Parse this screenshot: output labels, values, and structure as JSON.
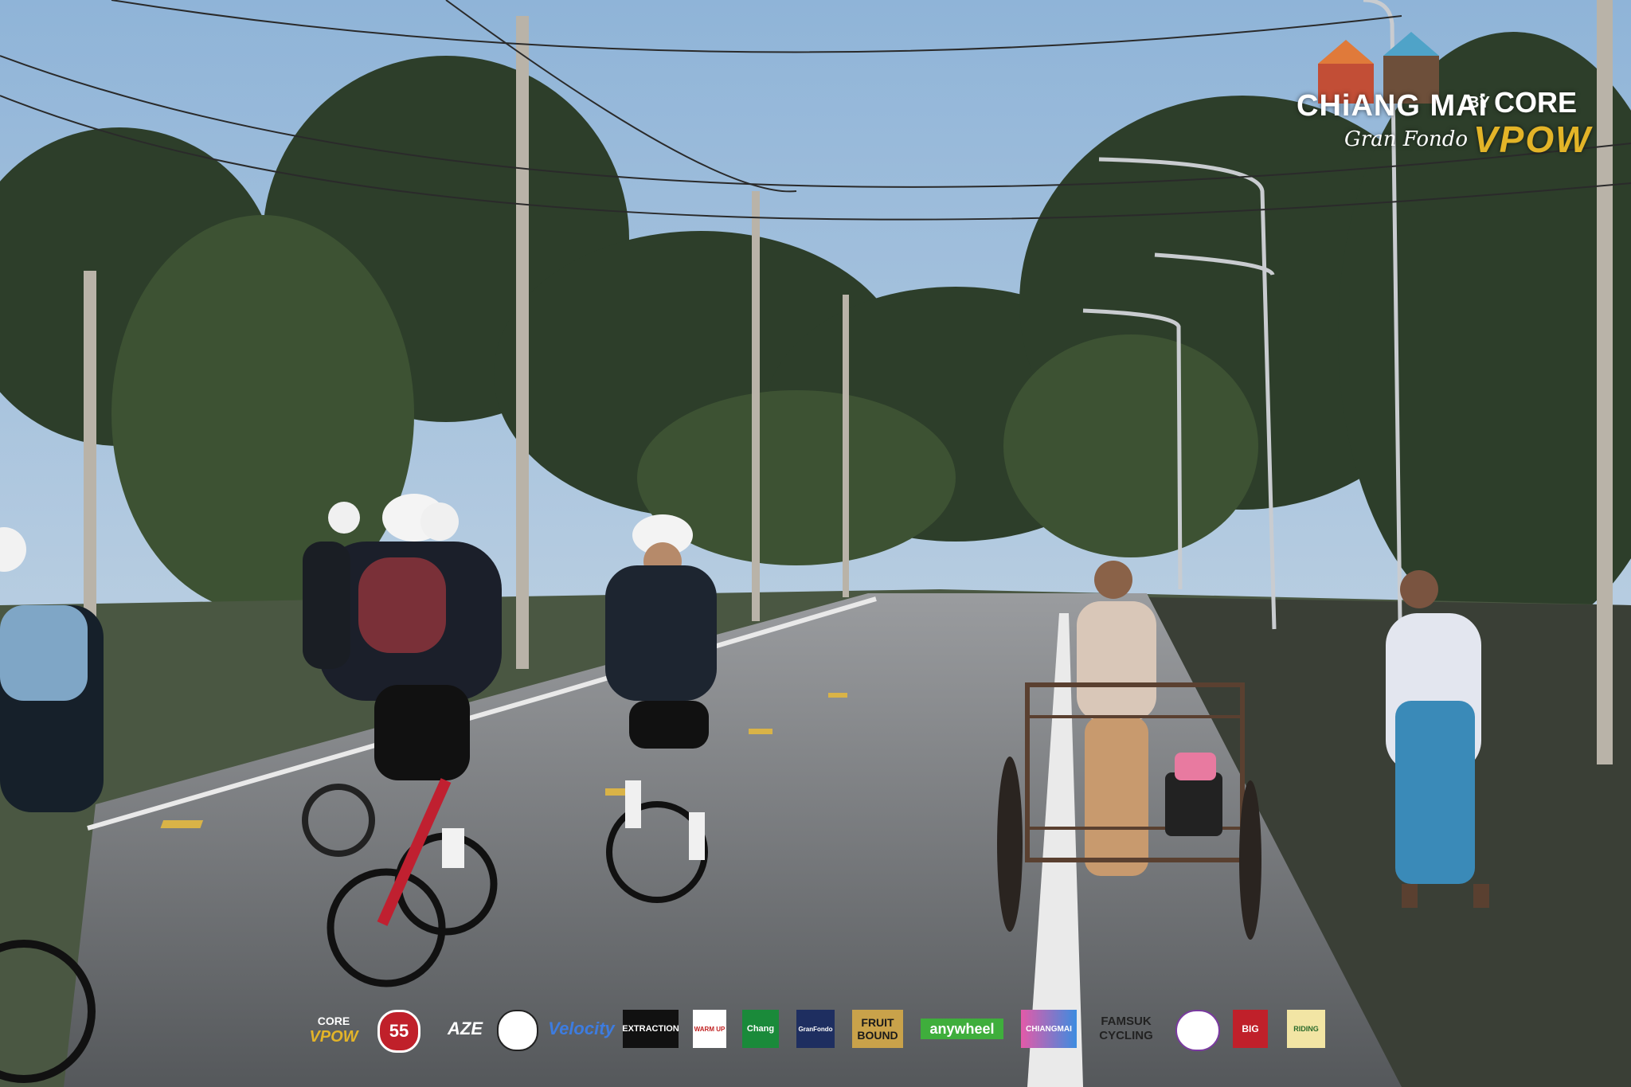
{
  "header_logo": {
    "title": "CHiANG MAi",
    "subtitle": "Gran Fondo",
    "by": "BY",
    "brand_top": "CORE",
    "brand_bottom": "VPOW"
  },
  "sponsors": [
    {
      "name": "CORE VPOW",
      "line1": "CORE",
      "line2": "VPOW"
    },
    {
      "name": "55 badge",
      "text": "55"
    },
    {
      "name": "BLAZE",
      "text": "AZE"
    },
    {
      "name": "round logo",
      "text": ""
    },
    {
      "name": "Velocity",
      "text": "Velocity"
    },
    {
      "name": "The Extraction",
      "text": "EXTRACTION"
    },
    {
      "name": "Warmup",
      "text": "WARM UP"
    },
    {
      "name": "Chang",
      "text": "Chang"
    },
    {
      "name": "GranFondo",
      "text": "GranFondo"
    },
    {
      "name": "FRUIT BOUND",
      "line1": "FRUIT",
      "line2": "BOUND"
    },
    {
      "name": "anywheel",
      "text": "anywheel"
    },
    {
      "name": "CHIANGMAI",
      "text": "CHIANGMAI"
    },
    {
      "name": "FAMSUK CYCLING",
      "line1": "FAMSUK",
      "line2": "CYCLING"
    },
    {
      "name": "circular emblem",
      "text": ""
    },
    {
      "name": "BIG SPRAY",
      "text": "BIG"
    },
    {
      "name": "RIDING",
      "text": "RIDING"
    }
  ],
  "colors": {
    "sky_top": "#8fb4d8",
    "sky_bottom": "#cfdde8",
    "road": "#6e7073",
    "foliage": "#263626",
    "vpow_gold": "#e3b428"
  }
}
